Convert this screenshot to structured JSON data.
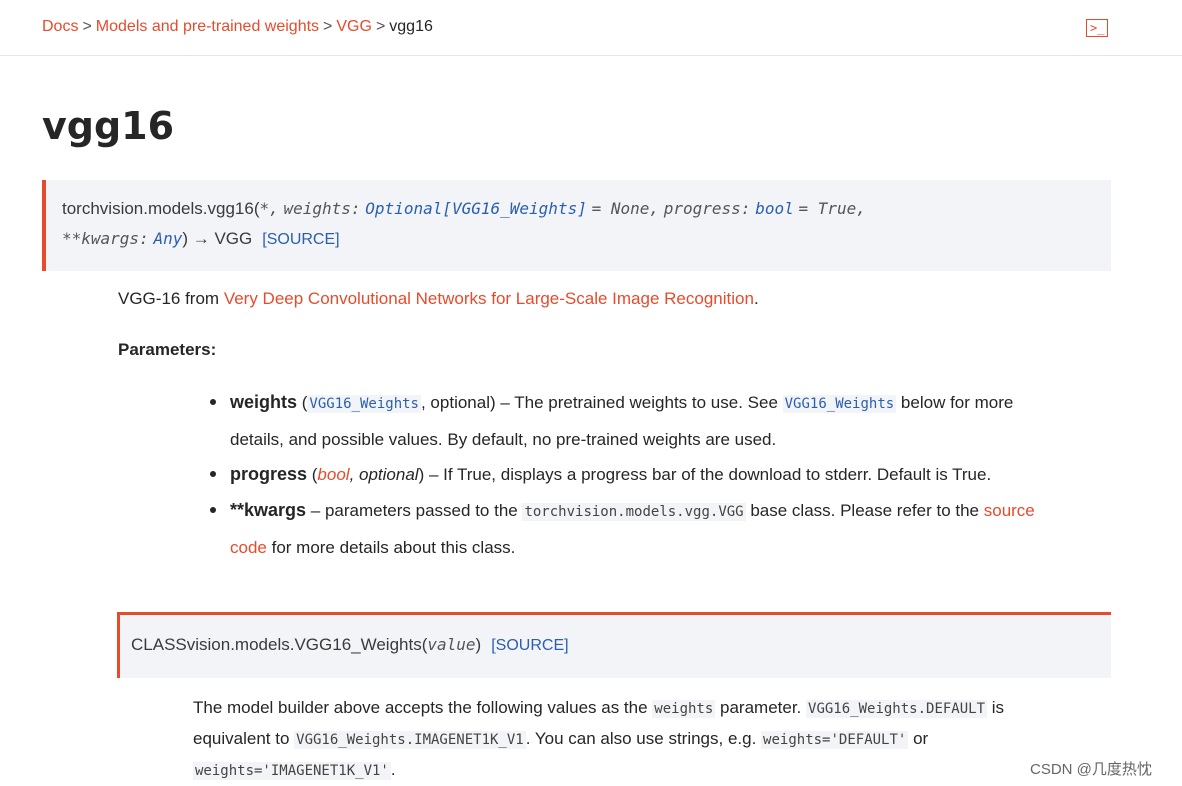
{
  "breadcrumb": {
    "items": [
      "Docs",
      "Models and pre-trained weights",
      "VGG",
      "vgg16"
    ],
    "separator": ">"
  },
  "toolbar": {
    "icon": "terminal-icon",
    "icon_glyph": ">_"
  },
  "page_title": "vgg16",
  "signature": {
    "prefix": "torchvision.models.vgg16(",
    "star": "*,",
    "p1_name": "weights:",
    "p1_type": "Optional",
    "p1_type_inner": "[VGG16_Weights]",
    "p1_default": "= None,",
    "p2_name": "progress:",
    "p2_type": "bool",
    "p2_default": "= True,",
    "p3_name": "**kwargs:",
    "p3_type": "Any",
    "suffix": ") → VGG",
    "source_label": "[SOURCE]"
  },
  "description": {
    "before": "VGG-16 from ",
    "link": "Very Deep Convolutional Networks for Large-Scale Image Recognition",
    "after": "."
  },
  "parameters": {
    "label": "Parameters:",
    "weights": {
      "name": "weights",
      "open": " (",
      "type": "VGG16_Weights",
      "type_suffix": ", optional) – The pretrained weights to use. See ",
      "ref": "VGG16_Weights",
      "rest1": " below for more",
      "rest2": "details, and possible values. By default, no pre-trained weights are used."
    },
    "progress": {
      "name": "progress",
      "open": " (",
      "type": "bool",
      "opt": ", optional",
      "rest": ") – If True, displays a progress bar of the download to stderr. Default is True."
    },
    "kwargs": {
      "name": "**kwargs",
      "dash": " – parameters passed to the ",
      "code": "torchvision.models.vgg.VGG",
      "mid": " base class. Please refer to the ",
      "link1": "source",
      "link2": "code",
      "rest": " for more details about this class."
    }
  },
  "class_block": {
    "kw": "CLASS",
    "name": "vision.models.VGG16_Weights(",
    "param": "value",
    "close": ")",
    "source_label": "[SOURCE]"
  },
  "note": {
    "t1": "The model builder above accepts the following values as the ",
    "c1": "weights",
    "t2": " parameter. ",
    "c2": "VGG16_Weights.DEFAULT",
    "t3": " is",
    "t4": "equivalent to ",
    "c3": "VGG16_Weights.IMAGENET1K_V1",
    "t5": ". You can also use strings, e.g. ",
    "c4": "weights='DEFAULT'",
    "t6": " or",
    "c5": "weights='IMAGENET1K_V1'",
    "t7": "."
  },
  "watermark": "CSDN @几度热忱",
  "colors": {
    "accent": "#e44c2c",
    "type_blue": "#2a5fb0",
    "code_bg": "#f3f4f7"
  }
}
